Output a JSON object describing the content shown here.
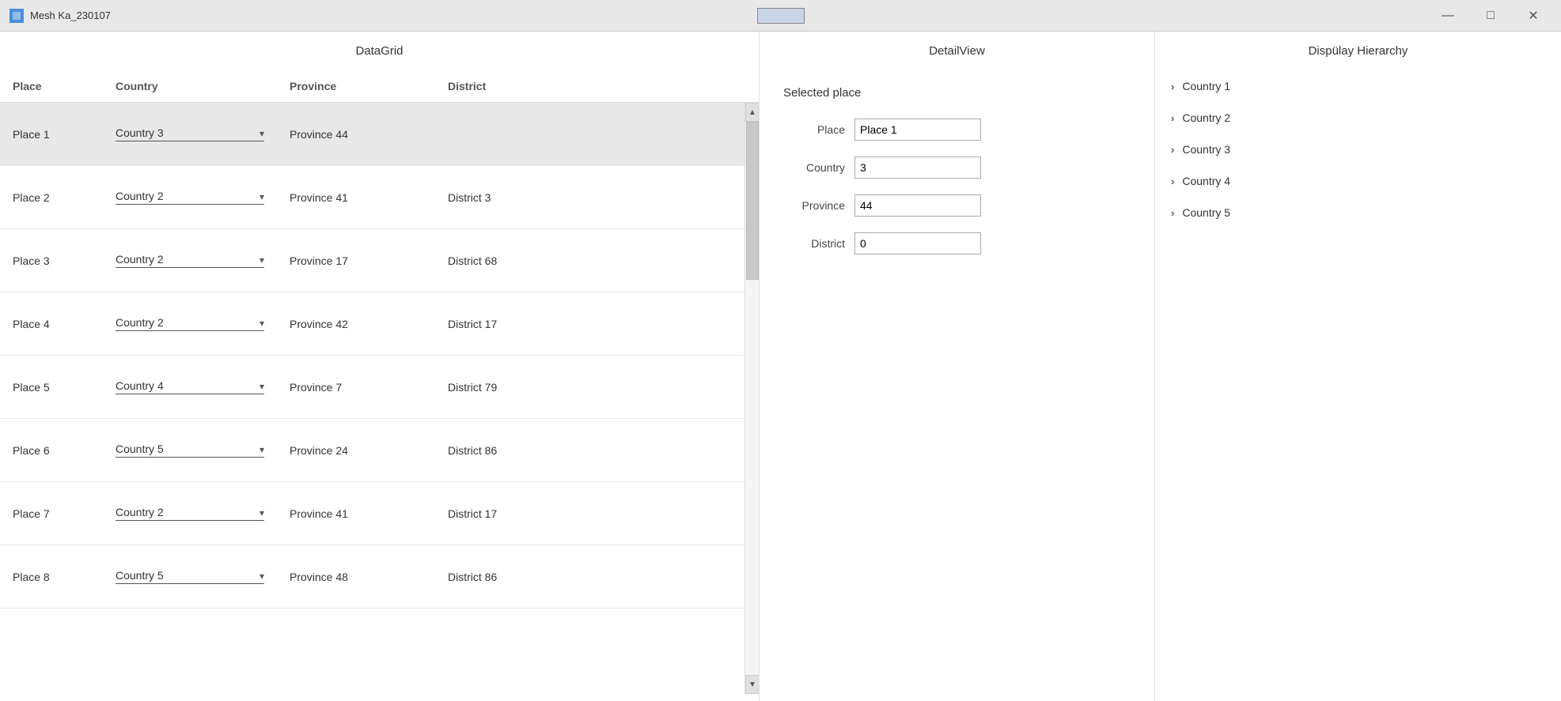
{
  "window": {
    "title": "Mesh Ka_230107",
    "minimize_label": "—",
    "maximize_label": "□",
    "close_label": "✕"
  },
  "datagrid": {
    "title": "DataGrid",
    "columns": {
      "place": "Place",
      "country": "Country",
      "province": "Province",
      "district": "District"
    },
    "rows": [
      {
        "place": "Place 1",
        "country": "Country 3",
        "province": "Province 44",
        "district": "",
        "selected": true
      },
      {
        "place": "Place 2",
        "country": "Country 2",
        "province": "Province 41",
        "district": "District 3",
        "selected": false
      },
      {
        "place": "Place 3",
        "country": "Country 2",
        "province": "Province 17",
        "district": "District 68",
        "selected": false
      },
      {
        "place": "Place 4",
        "country": "Country 2",
        "province": "Province 42",
        "district": "District 17",
        "selected": false
      },
      {
        "place": "Place 5",
        "country": "Country 4",
        "province": "Province 7",
        "district": "District 79",
        "selected": false
      },
      {
        "place": "Place 6",
        "country": "Country 5",
        "province": "Province 24",
        "district": "District 86",
        "selected": false
      },
      {
        "place": "Place 7",
        "country": "Country 2",
        "province": "Province 41",
        "district": "District 17",
        "selected": false
      },
      {
        "place": "Place 8",
        "country": "Country 5",
        "province": "Province 48",
        "district": "District 86",
        "selected": false
      }
    ]
  },
  "detail": {
    "title": "DetailView",
    "selected_place_label": "Selected place",
    "fields": {
      "place_label": "Place",
      "place_value": "Place 1",
      "country_label": "Country",
      "country_value": "3",
      "province_label": "Province",
      "province_value": "44",
      "district_label": "District",
      "district_value": "0"
    }
  },
  "hierarchy": {
    "title": "Dispülay Hierarchy",
    "items": [
      {
        "label": "Country 1"
      },
      {
        "label": "Country 2"
      },
      {
        "label": "Country 3"
      },
      {
        "label": "Country 4"
      },
      {
        "label": "Country 5"
      }
    ]
  }
}
